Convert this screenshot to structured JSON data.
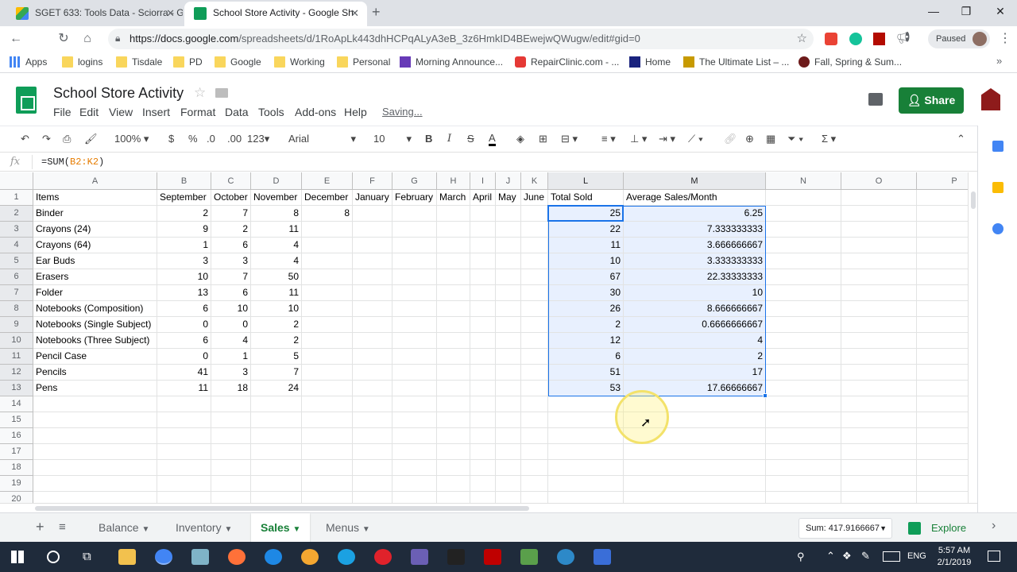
{
  "browser": {
    "tabs": [
      {
        "title": "SGET 633: Tools Data - Sciorra - G",
        "active": false,
        "favicon": "google-drive-icon"
      },
      {
        "title": "School Store Activity - Google Sh",
        "active": true,
        "favicon": "google-sheets-icon"
      }
    ],
    "url_host": "https://docs.google.com",
    "url_path": "/spreadsheets/d/1RoApLk443dhHCPqALyA3eB_3z6HmkID4BEwejwQWugw/edit#gid=0",
    "profile_status": "Paused",
    "bookmarks": [
      "Apps",
      "logins",
      "Tisdale",
      "PD",
      "Google",
      "Working",
      "Personal",
      "Morning Announce...",
      "RepairClinic.com - ...",
      "Home",
      "The Ultimate List – ...",
      "Fall, Spring & Sum..."
    ]
  },
  "sheets": {
    "doc_title": "School Store Activity",
    "menus": [
      "File",
      "Edit",
      "View",
      "Insert",
      "Format",
      "Data",
      "Tools",
      "Add-ons",
      "Help"
    ],
    "saving_status": "Saving...",
    "share_label": "Share",
    "toolbar": {
      "zoom": "100%",
      "currency": "$",
      "percent": "%",
      "dec_less": ".0",
      "dec_more": ".00",
      "format_more": "123",
      "font": "Arial",
      "font_size": "10",
      "bold": "B",
      "italic": "I",
      "strike": "S",
      "text_color": "A"
    },
    "fx_label": "fx",
    "formula_prefix": "=SUM(",
    "formula_range": "B2:K2",
    "formula_suffix": ")"
  },
  "grid": {
    "columns": [
      "A",
      "B",
      "C",
      "D",
      "E",
      "F",
      "G",
      "H",
      "I",
      "J",
      "K",
      "L",
      "M",
      "N",
      "O",
      "P"
    ],
    "rows": [
      "1",
      "2",
      "3",
      "4",
      "5",
      "6",
      "7",
      "8",
      "9",
      "10",
      "11",
      "12",
      "13",
      "14",
      "15",
      "16",
      "17",
      "18",
      "19",
      "20"
    ],
    "header_row": [
      "Items",
      "September",
      "October",
      "November",
      "December",
      "January",
      "February",
      "March",
      "April",
      "May",
      "June",
      "Total Sold",
      "Average Sales/Month"
    ],
    "data": [
      [
        "Binder",
        "2",
        "7",
        "8",
        "8",
        "",
        "",
        "",
        "",
        "",
        "",
        "25",
        "6.25"
      ],
      [
        "Crayons (24)",
        "9",
        "2",
        "11",
        "",
        "",
        "",
        "",
        "",
        "",
        "",
        "22",
        "7.333333333"
      ],
      [
        "Crayons (64)",
        "1",
        "6",
        "4",
        "",
        "",
        "",
        "",
        "",
        "",
        "",
        "11",
        "3.666666667"
      ],
      [
        "Ear Buds",
        "3",
        "3",
        "4",
        "",
        "",
        "",
        "",
        "",
        "",
        "",
        "10",
        "3.333333333"
      ],
      [
        "Erasers",
        "10",
        "7",
        "50",
        "",
        "",
        "",
        "",
        "",
        "",
        "",
        "67",
        "22.33333333"
      ],
      [
        "Folder",
        "13",
        "6",
        "11",
        "",
        "",
        "",
        "",
        "",
        "",
        "",
        "30",
        "10"
      ],
      [
        "Notebooks (Composition)",
        "6",
        "10",
        "10",
        "",
        "",
        "",
        "",
        "",
        "",
        "",
        "26",
        "8.666666667"
      ],
      [
        "Notebooks (Single Subject)",
        "0",
        "0",
        "2",
        "",
        "",
        "",
        "",
        "",
        "",
        "",
        "2",
        "0.6666666667"
      ],
      [
        "Notebooks (Three Subject)",
        "6",
        "4",
        "2",
        "",
        "",
        "",
        "",
        "",
        "",
        "",
        "12",
        "4"
      ],
      [
        "Pencil Case",
        "0",
        "1",
        "5",
        "",
        "",
        "",
        "",
        "",
        "",
        "",
        "6",
        "2"
      ],
      [
        "Pencils",
        "41",
        "3",
        "7",
        "",
        "",
        "",
        "",
        "",
        "",
        "",
        "51",
        "17"
      ],
      [
        "Pens",
        "11",
        "18",
        "24",
        "",
        "",
        "",
        "",
        "",
        "",
        "",
        "53",
        "17.66666667"
      ]
    ]
  },
  "sheet_tabs": [
    {
      "label": "Balance",
      "active": false
    },
    {
      "label": "Inventory",
      "active": false
    },
    {
      "label": "Sales",
      "active": true
    },
    {
      "label": "Menus",
      "active": false
    }
  ],
  "sum_label": "Sum: 417.9166667",
  "explore_label": "Explore",
  "taskbar": {
    "language": "ENG",
    "time": "5:57 AM",
    "date": "2/1/2019"
  },
  "colors": {
    "sheets_green": "#188038",
    "selection_blue": "#1a73e8",
    "selection_fill": "#e8f0fe"
  }
}
